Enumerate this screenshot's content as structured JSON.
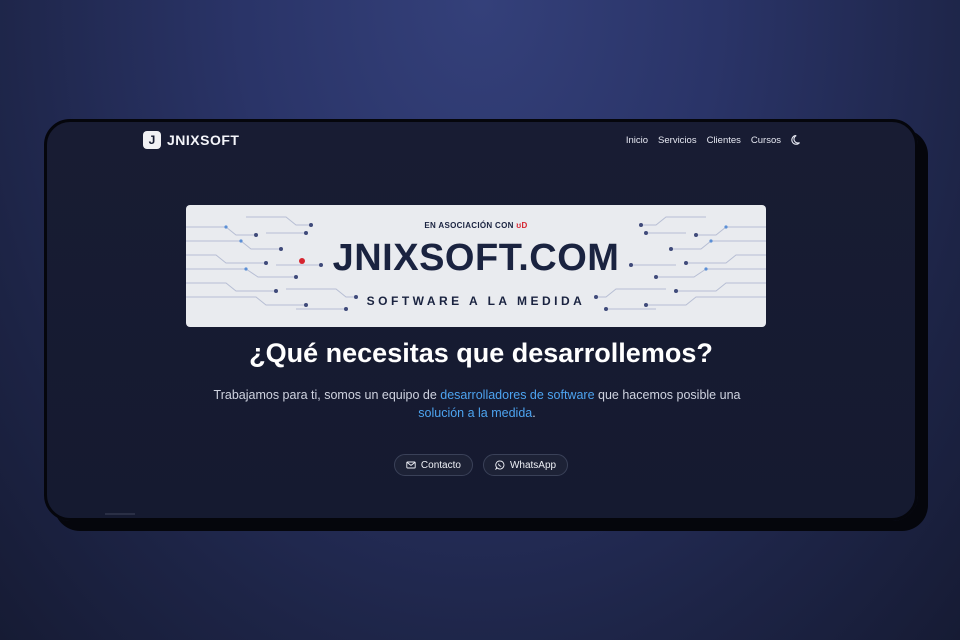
{
  "brand": {
    "logo_letter": "J",
    "name": "JNIXSOFT"
  },
  "nav": {
    "items": [
      "Inicio",
      "Servicios",
      "Clientes",
      "Cursos"
    ],
    "theme_toggle_icon": "moon-icon"
  },
  "banner": {
    "association": "EN ASOCIACIÓN CON",
    "association_mark": "ʊD",
    "title": "JNIXSOFT.COM",
    "subtitle": "SOFTWARE A LA MEDIDA"
  },
  "hero": {
    "headline": "¿Qué necesitas que desarrollemos?",
    "desc_part1": "Trabajamos para ti, somos un equipo de ",
    "desc_highlight1": "desarrolladores de software",
    "desc_part2": " que hacemos posible una ",
    "desc_highlight2": "solución a la medida",
    "desc_part3": "."
  },
  "actions": {
    "contact_label": "Contacto",
    "contact_icon": "mail-icon",
    "whatsapp_label": "WhatsApp",
    "whatsapp_icon": "whatsapp-icon"
  },
  "colors": {
    "background": "#2a3468",
    "frame": "#181c33",
    "accent": "#4da3f0",
    "banner_bg": "#e9ebef",
    "banner_text": "#1a2340",
    "banner_dot": "#d6242f"
  }
}
